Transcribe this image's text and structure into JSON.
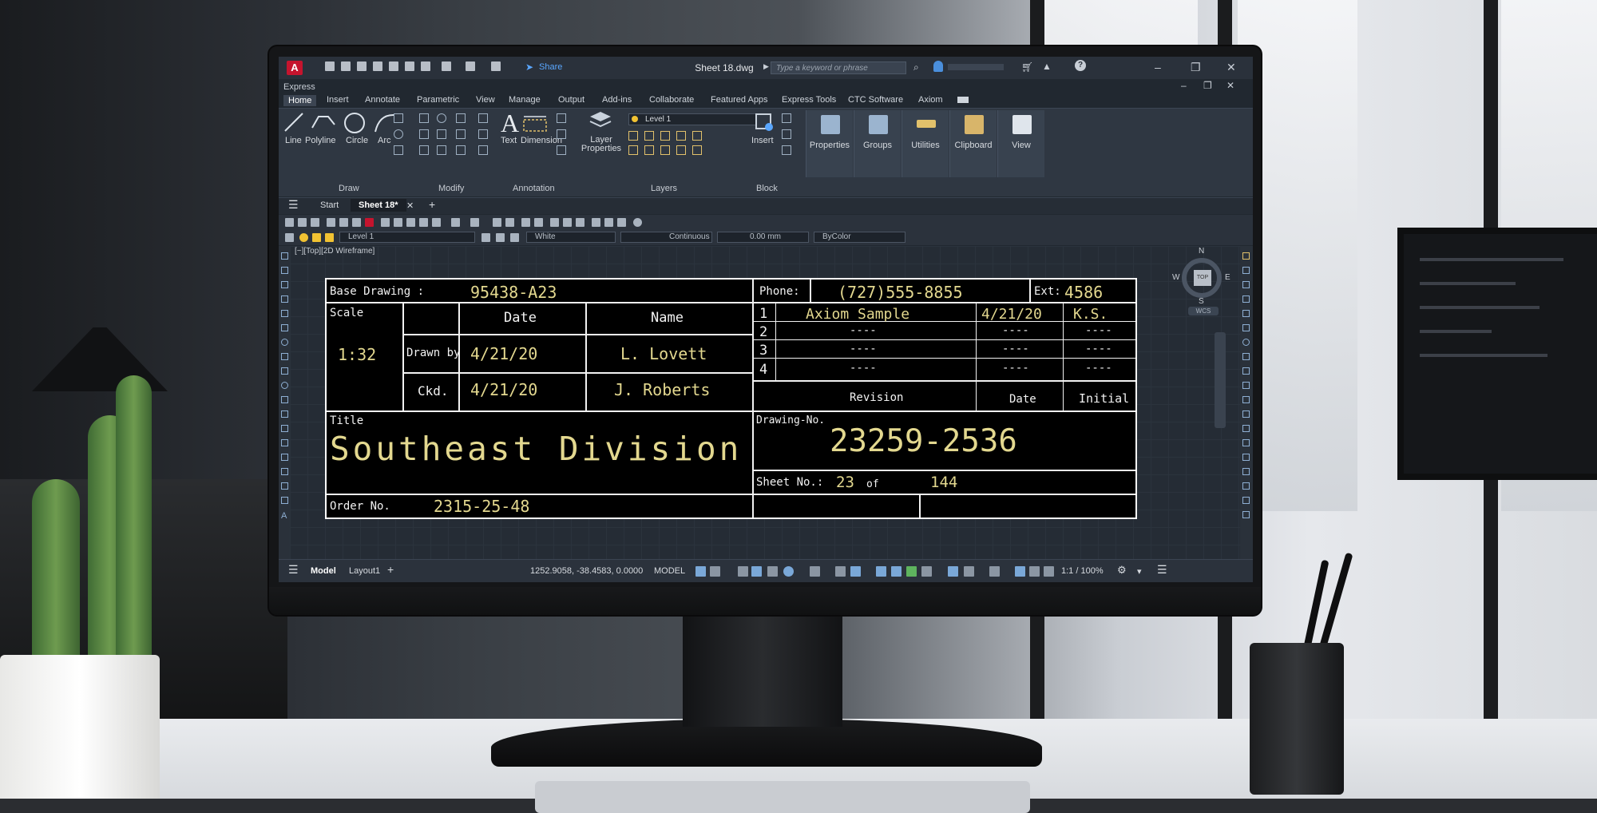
{
  "app": {
    "document_title": "Sheet 18.dwg",
    "share_label": "Share",
    "search_placeholder": "Type a keyword or phrase",
    "express_label": "Express",
    "logo_letter": "A"
  },
  "menu": [
    "Home",
    "Insert",
    "Annotate",
    "Parametric",
    "View",
    "Manage",
    "Output",
    "Add-ins",
    "Collaborate",
    "Featured Apps",
    "Express Tools",
    "CTC Software",
    "Axiom"
  ],
  "ribbon": {
    "draw_tools": [
      "Line",
      "Polyline",
      "Circle",
      "Arc"
    ],
    "annotation_tools": [
      "Text",
      "Dimension"
    ],
    "layer_properties": "Layer Properties",
    "insert": "Insert",
    "layer_name": "Level 1",
    "groups": [
      "Draw",
      "Modify",
      "Annotation",
      "Layers",
      "Block"
    ],
    "panels": [
      "Properties",
      "Groups",
      "Utilities",
      "Clipboard",
      "View"
    ]
  },
  "tabs": {
    "start": "Start",
    "current": "Sheet 18*"
  },
  "properties_bar": {
    "layer": "Level 1",
    "color": "White",
    "linetype": "Continuous",
    "lineweight": "0.00 mm",
    "plotstyle": "ByColor"
  },
  "viewport": {
    "label": "[−][Top][2D Wireframe]",
    "cube_top": "TOP",
    "north": "N",
    "south": "S",
    "east": "E",
    "west": "W",
    "wcs": "WCS"
  },
  "title_block": {
    "base_drawing_label": "Base Drawing :",
    "base_drawing_value": "95438-A23",
    "phone_label": "Phone:",
    "phone_value": "(727)555-8855",
    "ext_label": "Ext:",
    "ext_value": "4586",
    "scale_label": "Scale",
    "scale_value": "1:32",
    "date_header": "Date",
    "name_header": "Name",
    "drawn_by_label": "Drawn by",
    "drawn_date": "4/21/20",
    "drawn_name": "L. Lovett",
    "checked_label": "Ckd.",
    "checked_date": "4/21/20",
    "checked_name": "J. Roberts",
    "revisions": [
      {
        "no": "1",
        "revision": "Axiom Sample",
        "date": "4/21/20",
        "initial": "K.S."
      },
      {
        "no": "2",
        "revision": "----",
        "date": "----",
        "initial": "----"
      },
      {
        "no": "3",
        "revision": "----",
        "date": "----",
        "initial": "----"
      },
      {
        "no": "4",
        "revision": "----",
        "date": "----",
        "initial": "----"
      }
    ],
    "revision_header": "Revision",
    "rev_date_header": "Date",
    "initial_header": "Initial",
    "title_label": "Title",
    "title_value": "Southeast Division",
    "drawing_no_label": "Drawing-No.",
    "drawing_no_value": "23259-2536",
    "sheet_no_label": "Sheet No.:",
    "sheet_no_value": "23",
    "of_label": "of",
    "sheet_total": "144",
    "order_no_label": "Order No.",
    "order_no_value": "2315-25-48"
  },
  "status": {
    "model_tab": "Model",
    "layout_tab": "Layout1",
    "coordinates": "1252.9058, -38.4583, 0.0000",
    "space": "MODEL",
    "scale": "1:1 / 100%"
  }
}
